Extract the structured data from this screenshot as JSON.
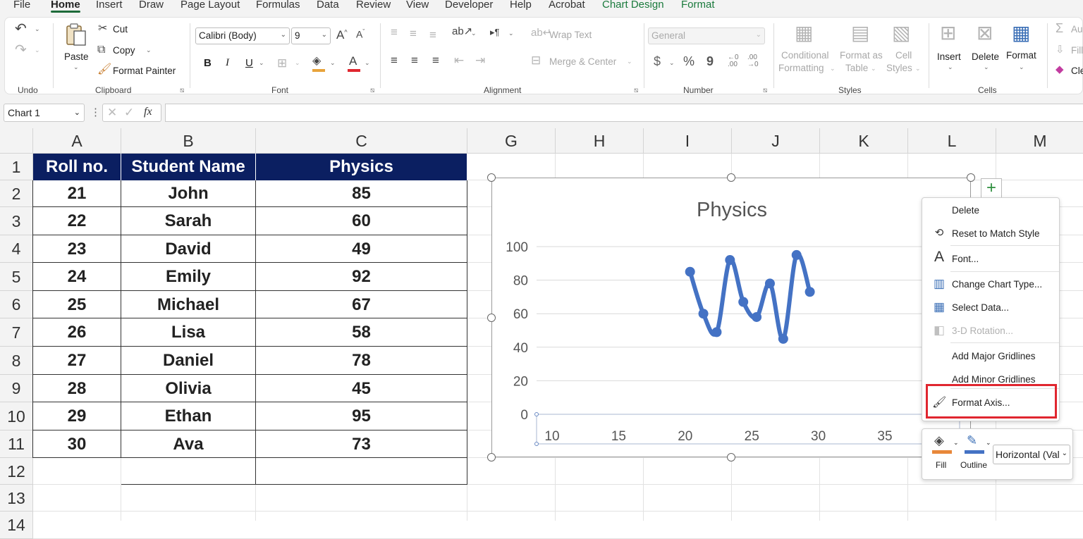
{
  "menu_tabs": [
    {
      "label": "File",
      "active": false
    },
    {
      "label": "Home",
      "active": true
    },
    {
      "label": "Insert",
      "active": false
    },
    {
      "label": "Draw",
      "active": false
    },
    {
      "label": "Page Layout",
      "active": false
    },
    {
      "label": "Formulas",
      "active": false
    },
    {
      "label": "Data",
      "active": false
    },
    {
      "label": "Review",
      "active": false
    },
    {
      "label": "View",
      "active": false
    },
    {
      "label": "Developer",
      "active": false
    },
    {
      "label": "Help",
      "active": false
    },
    {
      "label": "Acrobat",
      "active": false
    },
    {
      "label": "Chart Design",
      "active": false,
      "contextual": true
    },
    {
      "label": "Format",
      "active": false,
      "contextual": true
    }
  ],
  "ribbon": {
    "undo": {
      "group_label": "Undo"
    },
    "clipboard": {
      "group_label": "Clipboard",
      "paste": "Paste",
      "cut": "Cut",
      "copy": "Copy",
      "format_painter": "Format Painter"
    },
    "font": {
      "group_label": "Font",
      "font_name": "Calibri (Body)",
      "font_size": "9",
      "bold": "B",
      "italic": "I",
      "underline": "U"
    },
    "alignment": {
      "group_label": "Alignment",
      "wrap_text": "Wrap Text",
      "merge_center": "Merge & Center"
    },
    "number": {
      "group_label": "Number",
      "format": "General",
      "currency": "$",
      "percent": "%",
      "comma": "9",
      "inc_decimal": "←0\n.00",
      "dec_decimal": ".00\n→0"
    },
    "styles": {
      "group_label": "Styles",
      "conditional": "Conditional",
      "conditional2": "Formatting",
      "format_table": "Format as",
      "format_table2": "Table",
      "cell_styles": "Cell",
      "cell_styles2": "Styles"
    },
    "cells": {
      "group_label": "Cells",
      "insert": "Insert",
      "delete": "Delete",
      "format": "Format"
    },
    "editing": {
      "autosum": "Au",
      "fill": "Fill",
      "clear": "Cle"
    }
  },
  "formula_bar": {
    "name_box": "Chart 1",
    "fx": "fx",
    "value": ""
  },
  "columns": [
    "A",
    "B",
    "C",
    "G",
    "H",
    "I",
    "J",
    "K",
    "L",
    "M"
  ],
  "rows": [
    "1",
    "2",
    "3",
    "4",
    "5",
    "6",
    "7",
    "8",
    "9",
    "10",
    "11",
    "12",
    "13",
    "14"
  ],
  "table": {
    "headers": [
      "Roll no.",
      "Student Name",
      "Physics"
    ],
    "rows": [
      [
        "21",
        "John",
        "85"
      ],
      [
        "22",
        "Sarah",
        "60"
      ],
      [
        "23",
        "David",
        "49"
      ],
      [
        "24",
        "Emily",
        "92"
      ],
      [
        "25",
        "Michael",
        "67"
      ],
      [
        "26",
        "Lisa",
        "58"
      ],
      [
        "27",
        "Daniel",
        "78"
      ],
      [
        "28",
        "Olivia",
        "45"
      ],
      [
        "29",
        "Ethan",
        "95"
      ],
      [
        "30",
        "Ava",
        "73"
      ]
    ],
    "header_bg": "#0b1f61"
  },
  "chart_data": {
    "type": "scatter",
    "title": "Physics",
    "x": [
      21,
      22,
      23,
      24,
      25,
      26,
      27,
      28,
      29,
      30
    ],
    "y": [
      85,
      60,
      49,
      92,
      67,
      58,
      78,
      45,
      95,
      73
    ],
    "xlim": [
      10,
      35
    ],
    "ylim": [
      0,
      100
    ],
    "xticks": [
      10,
      15,
      20,
      25,
      30,
      35
    ],
    "yticks": [
      0,
      20,
      40,
      60,
      80,
      100
    ],
    "grid": true,
    "line": "smoothed",
    "color": "#4472c4"
  },
  "context_menu": {
    "items": [
      {
        "label": "Delete",
        "icon": "none",
        "disabled": false
      },
      {
        "label": "Reset to Match Style",
        "icon": "reset-style-icon",
        "disabled": false
      },
      {
        "label": "Font...",
        "icon": "font-icon",
        "disabled": false
      },
      {
        "label": "Change Chart Type...",
        "icon": "chart-type-icon",
        "disabled": false
      },
      {
        "label": "Select Data...",
        "icon": "select-data-icon",
        "disabled": false
      },
      {
        "label": "3-D Rotation...",
        "icon": "rotation-icon",
        "disabled": true
      },
      {
        "label": "Add Major Gridlines",
        "icon": "none",
        "disabled": false
      },
      {
        "label": "Add Minor Gridlines",
        "icon": "none",
        "disabled": false
      },
      {
        "label": "Format Axis...",
        "icon": "format-axis-icon",
        "disabled": false,
        "highlighted": true
      }
    ],
    "highlight_color": "#e0262f"
  },
  "mini_toolbar": {
    "fill": "Fill",
    "outline": "Outline",
    "element": "Horizontal (Val"
  }
}
